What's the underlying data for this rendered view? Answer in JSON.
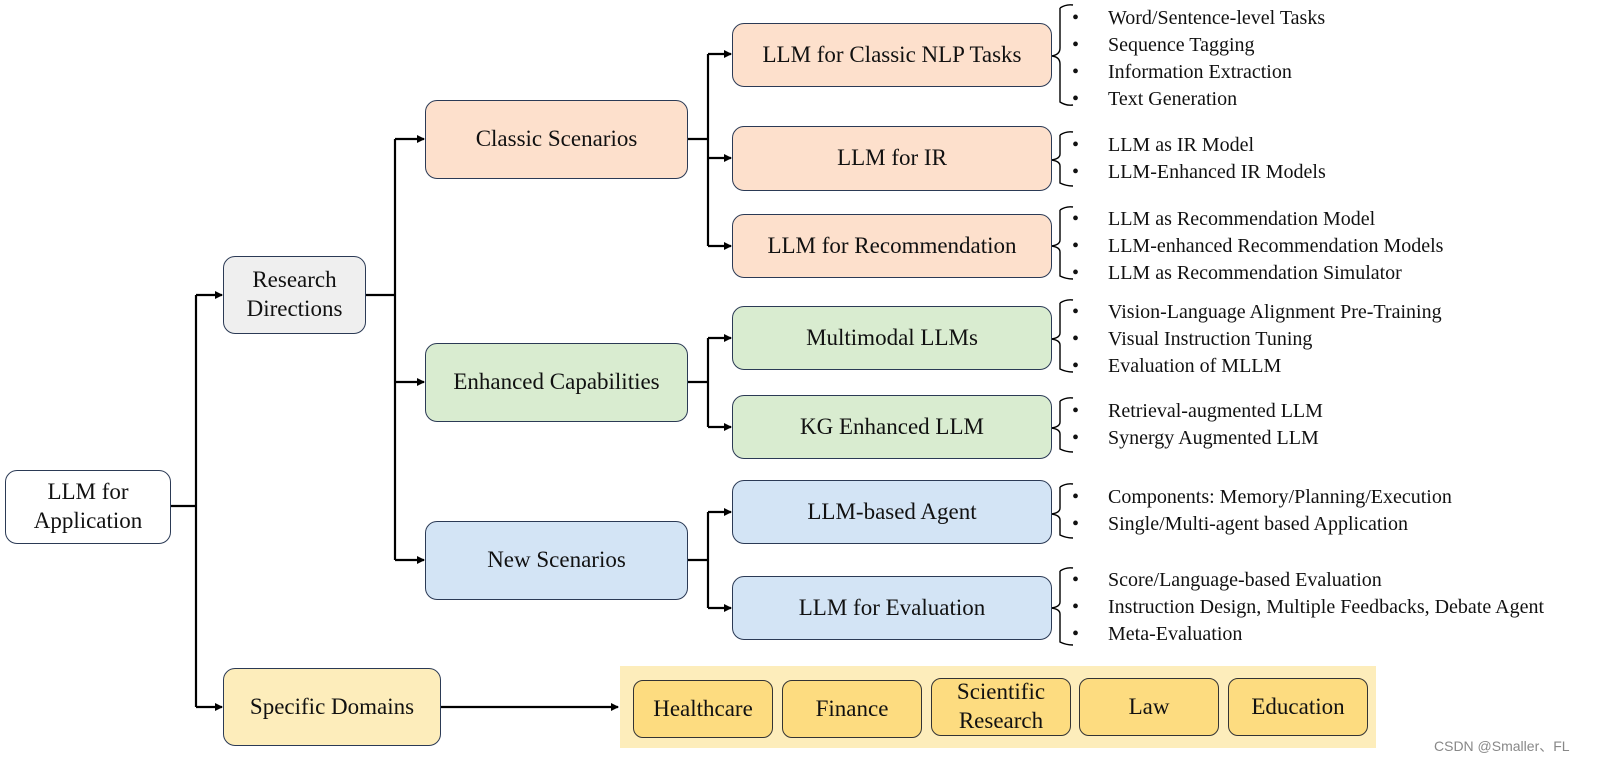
{
  "root": {
    "label": "LLM for Application"
  },
  "level1": {
    "research_directions": {
      "label": "Research Directions"
    },
    "specific_domains": {
      "label": "Specific Domains"
    }
  },
  "level2": [
    {
      "label": "Classic Scenarios",
      "color": "#fde0cc"
    },
    {
      "label": "Enhanced Capabilities",
      "color": "#d9ecd0"
    },
    {
      "label": "New Scenarios",
      "color": "#d3e4f5"
    }
  ],
  "level3": [
    {
      "label": "LLM for Classic NLP Tasks",
      "items": [
        "Word/Sentence-level Tasks",
        "Sequence Tagging",
        "Information Extraction",
        "Text Generation"
      ]
    },
    {
      "label": "LLM for IR",
      "items": [
        "LLM as IR Model",
        "LLM-Enhanced IR Models"
      ]
    },
    {
      "label": "LLM for Recommendation",
      "items": [
        "LLM as Recommendation Model",
        "LLM-enhanced Recommendation Models",
        "LLM as Recommendation Simulator"
      ]
    },
    {
      "label": "Multimodal LLMs",
      "items": [
        "Vision-Language Alignment Pre-Training",
        "Visual Instruction Tuning",
        "Evaluation of MLLM"
      ]
    },
    {
      "label": "KG Enhanced LLM",
      "items": [
        "Retrieval-augmented LLM",
        "Synergy Augmented LLM"
      ]
    },
    {
      "label": "LLM-based Agent",
      "items": [
        "Components: Memory/Planning/Execution",
        "Single/Multi-agent based Application"
      ]
    },
    {
      "label": "LLM for Evaluation",
      "items": [
        "Score/Language-based Evaluation",
        "Instruction Design, Multiple Feedbacks, Debate Agent",
        "Meta-Evaluation"
      ]
    }
  ],
  "domains": [
    "Healthcare",
    "Finance",
    "Scientific Research",
    "Law",
    "Education"
  ],
  "watermark": "CSDN @Smaller、FL",
  "colors": {
    "classic": "#fde0cc",
    "enhanced": "#d9ecd0",
    "new": "#d3e4f5",
    "domains_band": "#fdedbb",
    "domain_item": "#fddc80",
    "research": "#efefef",
    "border": "#2b3a55"
  }
}
